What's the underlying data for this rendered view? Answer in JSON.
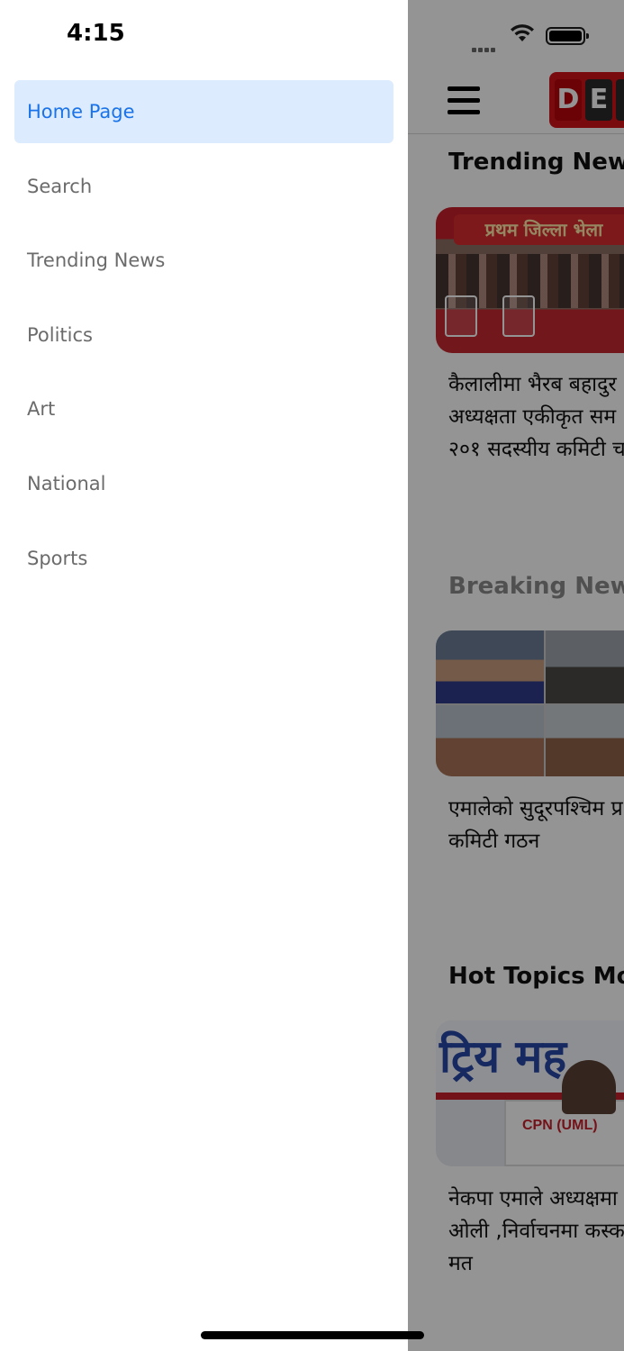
{
  "status_bar": {
    "time": "4:15"
  },
  "drawer": {
    "items": [
      {
        "label": "Home Page",
        "active": true
      },
      {
        "label": "Search",
        "active": false
      },
      {
        "label": "Trending News",
        "active": false
      },
      {
        "label": "Politics",
        "active": false
      },
      {
        "label": "Art",
        "active": false
      },
      {
        "label": "National",
        "active": false
      },
      {
        "label": "Sports",
        "active": false
      }
    ]
  },
  "app": {
    "brand_logo_letters": [
      "D",
      "E",
      ""
    ],
    "sections": [
      {
        "title": "Trending News",
        "image_banner_text": "प्रथम जिल्ला भेला",
        "headline": "कैलालीमा भैरब बहादुर\nअध्यक्षता एकीकृत सम\n२०१ सदस्यीय कमिटी च"
      },
      {
        "title": "Breaking News",
        "headline": "एमालेको सुदूरपश्चिम प्र\nकमिटी गठन"
      },
      {
        "title": "Hot Topics Mor",
        "image_banner_text": "ट्रिय मह",
        "image_podium_text": "CPN (UML)",
        "headline": "नेकपा एमाले अध्यक्षमा\nओली ,निर्वाचनमा कस्क\nमत"
      }
    ]
  },
  "colors": {
    "accent": "#1a73e8",
    "active_bg": "#dcebfd",
    "menu_text": "#6b6b6b",
    "brand_red": "#d0141a"
  }
}
